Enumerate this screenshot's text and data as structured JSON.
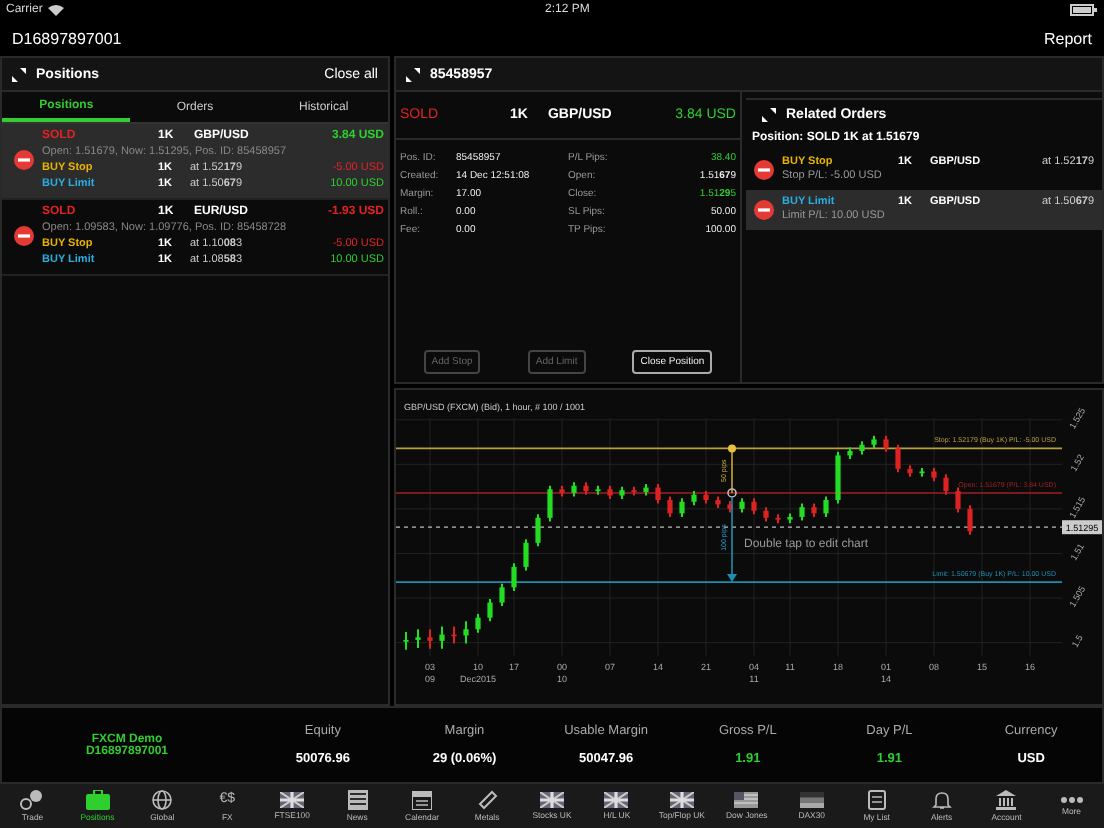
{
  "status_bar": {
    "carrier": "Carrier",
    "time": "2:12 PM"
  },
  "header": {
    "account": "D16897897001",
    "report": "Report"
  },
  "positions_panel": {
    "title": "Positions",
    "close_all": "Close all",
    "tabs": [
      {
        "label": "Positions",
        "selected": true
      },
      {
        "label": "Orders",
        "selected": false
      },
      {
        "label": "Historical",
        "selected": false
      }
    ],
    "positions": [
      {
        "side": "SOLD",
        "size": "1K",
        "symbol": "GBP/USD",
        "pl": "3.84 USD",
        "profit": true,
        "selected": true,
        "details": "Open: 1.51679, Now: 1.51295, Pos. ID: 85458957",
        "orders": [
          {
            "type": "BUY Stop",
            "kind": "stop",
            "size": "1K",
            "price": "at 1.52**17**9",
            "pl": "-5.00 USD",
            "profit": false
          },
          {
            "type": "BUY Limit",
            "kind": "limit",
            "size": "1K",
            "price": "at 1.50**67**9",
            "pl": "10.00 USD",
            "profit": true
          }
        ]
      },
      {
        "side": "SOLD",
        "size": "1K",
        "symbol": "EUR/USD",
        "pl": "-1.93 USD",
        "profit": false,
        "selected": false,
        "details": "Open: 1.09583, Now: 1.09776, Pos. ID: 85458728",
        "orders": [
          {
            "type": "BUY Stop",
            "kind": "stop",
            "size": "1K",
            "price": "at 1.10**08**3",
            "pl": "-5.00 USD",
            "profit": false
          },
          {
            "type": "BUY Limit",
            "kind": "limit",
            "size": "1K",
            "price": "at 1.08**58**3",
            "pl": "10.00 USD",
            "profit": true
          }
        ]
      }
    ]
  },
  "detail": {
    "title": "85458957",
    "side": "SOLD",
    "size": "1K",
    "symbol": "GBP/USD",
    "pl": "3.84 USD",
    "profit": true,
    "left_fields": [
      {
        "label": "Pos. ID:",
        "value": "85458957"
      },
      {
        "label": "Created:",
        "value": "14 Dec 12:51:08"
      },
      {
        "label": "Margin:",
        "value": "17.00"
      },
      {
        "label": "Roll.:",
        "value": "0.00"
      },
      {
        "label": "Fee:",
        "value": "0.00"
      }
    ],
    "right_fields": [
      {
        "label": "P/L Pips:",
        "value": "38.40",
        "profit": true
      },
      {
        "label": "Open:",
        "value": "1.51**67**9",
        "profit": false
      },
      {
        "label": "Close:",
        "value": "1.51**29**5",
        "profit": true
      },
      {
        "label": "SL Pips:",
        "value": "50.00",
        "profit": false
      },
      {
        "label": "TP Pips:",
        "value": "100.00",
        "profit": false
      }
    ],
    "buttons": [
      {
        "label": "Add Stop",
        "disabled": true
      },
      {
        "label": "Add Limit",
        "disabled": true
      },
      {
        "label": "Close Position",
        "disabled": false
      }
    ]
  },
  "related": {
    "title": "Related Orders",
    "position": "Position: SOLD 1K at 1.51679",
    "orders": [
      {
        "type": "BUY Stop",
        "kind": "stop",
        "size": "1K",
        "symbol": "GBP/USD",
        "price": "at 1.52**17**9",
        "sub": "Stop P/L: -5.00 USD",
        "selected": false
      },
      {
        "type": "BUY Limit",
        "kind": "limit",
        "size": "1K",
        "symbol": "GBP/USD",
        "price": "at 1.50**67**9",
        "sub": "Limit P/L: 10.00 USD",
        "selected": true
      }
    ]
  },
  "chart": {
    "title": "GBP/USD (FXCM) (Bid), 1 hour, # 100 / 1001",
    "hint": "Double tap to edit chart",
    "x_sublabels": [
      "09",
      "Dec2015",
      "10",
      "11",
      "14"
    ],
    "stop_distance": "50 pips",
    "limit_distance": "100 pips",
    "chart_data": {
      "type": "candlestick",
      "ylim": [
        1.4985,
        1.5252
      ],
      "grid": true,
      "ref_lines": [
        {
          "axis": "y",
          "value": 1.52179,
          "color": "#b8a040",
          "label": "Stop: 1.52179 (Buy 1K) P/L: -5.00 USD"
        },
        {
          "axis": "y",
          "value": 1.51679,
          "color": "#a02020",
          "label": "Open: 1.51679 (P/L: 3.84 USD)"
        },
        {
          "axis": "y",
          "value": 1.51295,
          "color": "#bbbbbb"
        },
        {
          "axis": "y",
          "value": 1.50679,
          "color": "#1e8fb0",
          "label": "Limit: 1.50679 (Buy 1K) P/L: 10.00 USD"
        }
      ],
      "annotations": [
        {
          "y": 1.51295,
          "text": "1.51295"
        }
      ],
      "yticks": [
        {
          "value": 1.525,
          "label": "1.525"
        },
        {
          "value": 1.52,
          "label": "1.52"
        },
        {
          "value": 1.515,
          "label": "1.515"
        },
        {
          "value": 1.51,
          "label": "1.51"
        },
        {
          "value": 1.505,
          "label": "1.505"
        },
        {
          "value": 1.5,
          "label": "1.5"
        }
      ],
      "categories": [
        null,
        null,
        "03",
        null,
        null,
        null,
        "10",
        null,
        null,
        "17",
        null,
        null,
        null,
        "00",
        null,
        null,
        null,
        "07",
        null,
        null,
        null,
        "14",
        null,
        null,
        null,
        "21",
        null,
        null,
        null,
        "04",
        null,
        null,
        "11",
        null,
        null,
        null,
        "18",
        null,
        null,
        null,
        "01",
        null,
        null,
        null,
        "08",
        null,
        null,
        null,
        "15",
        null,
        null,
        null,
        "16",
        null
      ],
      "ohlc": [
        [
          1.5001,
          1.5012,
          1.4992,
          1.5003
        ],
        [
          1.5003,
          1.5015,
          1.4994,
          1.5006
        ],
        [
          1.5006,
          1.5015,
          1.4993,
          1.5002
        ],
        [
          1.5002,
          1.5018,
          1.4993,
          1.5009
        ],
        [
          1.5009,
          1.5018,
          1.4999,
          1.5008
        ],
        [
          1.5008,
          1.5024,
          1.4999,
          1.5015
        ],
        [
          1.5015,
          1.5032,
          1.5011,
          1.5028
        ],
        [
          1.5028,
          1.5049,
          1.5024,
          1.5045
        ],
        [
          1.5045,
          1.5066,
          1.5041,
          1.5062
        ],
        [
          1.5062,
          1.5089,
          1.5058,
          1.5085
        ],
        [
          1.5085,
          1.5116,
          1.5081,
          1.5112
        ],
        [
          1.5112,
          1.5144,
          1.5108,
          1.514
        ],
        [
          1.514,
          1.5176,
          1.5136,
          1.5172
        ],
        [
          1.5172,
          1.5176,
          1.5164,
          1.5168
        ],
        [
          1.5168,
          1.518,
          1.5164,
          1.5176
        ],
        [
          1.5176,
          1.518,
          1.5166,
          1.517
        ],
        [
          1.517,
          1.5176,
          1.5166,
          1.5172
        ],
        [
          1.5172,
          1.5176,
          1.5161,
          1.5165
        ],
        [
          1.5165,
          1.5175,
          1.5161,
          1.5171
        ],
        [
          1.5171,
          1.5175,
          1.5165,
          1.5169
        ],
        [
          1.5169,
          1.5178,
          1.5165,
          1.5174
        ],
        [
          1.5174,
          1.5178,
          1.5156,
          1.516
        ],
        [
          1.516,
          1.5164,
          1.5141,
          1.5145
        ],
        [
          1.5145,
          1.5162,
          1.5141,
          1.5158
        ],
        [
          1.5158,
          1.517,
          1.5154,
          1.5166
        ],
        [
          1.5166,
          1.517,
          1.5156,
          1.516
        ],
        [
          1.516,
          1.5164,
          1.5151,
          1.5155
        ],
        [
          1.5155,
          1.5159,
          1.5146,
          1.515
        ],
        [
          1.515,
          1.5162,
          1.5146,
          1.5158
        ],
        [
          1.5158,
          1.5162,
          1.5144,
          1.5148
        ],
        [
          1.5148,
          1.5152,
          1.5136,
          1.514
        ],
        [
          1.514,
          1.5144,
          1.5134,
          1.5138
        ],
        [
          1.5138,
          1.5145,
          1.5134,
          1.5141
        ],
        [
          1.5141,
          1.5156,
          1.5137,
          1.5152
        ],
        [
          1.5152,
          1.5156,
          1.5141,
          1.5145
        ],
        [
          1.5145,
          1.5164,
          1.5141,
          1.516
        ],
        [
          1.516,
          1.5214,
          1.5156,
          1.521
        ],
        [
          1.521,
          1.5219,
          1.5206,
          1.5215
        ],
        [
          1.5215,
          1.5226,
          1.5211,
          1.5222
        ],
        [
          1.5222,
          1.5232,
          1.5218,
          1.5228
        ],
        [
          1.5228,
          1.5232,
          1.5214,
          1.5218
        ],
        [
          1.5218,
          1.5222,
          1.5191,
          1.5195
        ],
        [
          1.5195,
          1.5199,
          1.5186,
          1.519
        ],
        [
          1.519,
          1.5196,
          1.5186,
          1.5192
        ],
        [
          1.5192,
          1.5196,
          1.5181,
          1.5185
        ],
        [
          1.5185,
          1.5189,
          1.5166,
          1.517
        ],
        [
          1.517,
          1.5174,
          1.5146,
          1.515
        ],
        [
          1.515,
          1.5154,
          1.5121,
          1.5125
        ],
        null,
        null,
        null,
        null,
        null,
        null
      ]
    }
  },
  "summary": {
    "name": "FXCM Demo",
    "account": "D16897897001",
    "columns": [
      {
        "label": "Equity",
        "value": "50076.96",
        "profit": false
      },
      {
        "label": "Margin",
        "value": "29 (0.06%)",
        "profit": false
      },
      {
        "label": "Usable Margin",
        "value": "50047.96",
        "profit": false
      },
      {
        "label": "Gross P/L",
        "value": "1.91",
        "profit": true
      },
      {
        "label": "Day P/L",
        "value": "1.91",
        "profit": true
      },
      {
        "label": "Currency",
        "value": "USD",
        "profit": false
      }
    ]
  },
  "tab_bar": [
    {
      "label": "Trade",
      "kind": "coins",
      "selected": false
    },
    {
      "label": "Positions",
      "kind": "briefcase",
      "selected": true
    },
    {
      "label": "Global",
      "kind": "globe",
      "selected": false
    },
    {
      "label": "FX",
      "kind": "glyph",
      "glyph": "€$",
      "selected": false
    },
    {
      "label": "FTSE100",
      "kind": "flag-uk",
      "selected": false
    },
    {
      "label": "News",
      "kind": "news",
      "selected": false
    },
    {
      "label": "Calendar",
      "kind": "calendar",
      "selected": false
    },
    {
      "label": "Metals",
      "kind": "ingot",
      "selected": false
    },
    {
      "label": "Stocks UK",
      "kind": "flag-uk",
      "selected": false
    },
    {
      "label": "H/L UK",
      "kind": "flag-uk",
      "selected": false
    },
    {
      "label": "Top/Flop UK",
      "kind": "flag-uk",
      "selected": false
    },
    {
      "label": "Dow Jones",
      "kind": "flag-us",
      "selected": false
    },
    {
      "label": "DAX30",
      "kind": "flag-de",
      "selected": false
    },
    {
      "label": "My List",
      "kind": "list",
      "selected": false
    },
    {
      "label": "Alerts",
      "kind": "bell",
      "selected": false
    },
    {
      "label": "Account",
      "kind": "bank",
      "selected": false
    },
    {
      "label": "More",
      "kind": "dots",
      "selected": false
    }
  ]
}
